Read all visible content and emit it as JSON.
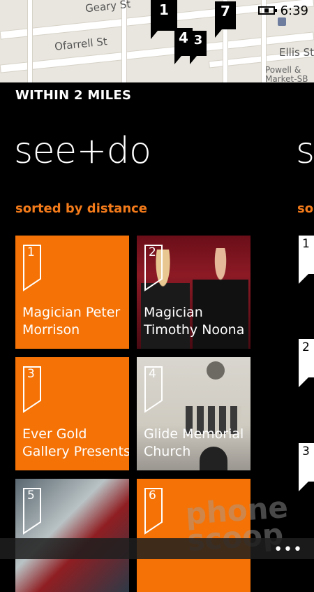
{
  "map": {
    "streets": [
      "Geary St",
      "Ofarrell St",
      "Ellis St"
    ],
    "station_label": "Powell & Market-SB",
    "pins": [
      "1",
      "7",
      "4",
      "3"
    ]
  },
  "status": {
    "time": "6:39",
    "battery_icon": "battery-charging-icon"
  },
  "header": {
    "within": "WITHIN 2 MILES"
  },
  "panorama": {
    "section_title": "see+do",
    "next_title_peek": "s",
    "sorted_label": "sorted by distance",
    "next_sorted_peek": "so"
  },
  "tiles": [
    {
      "num": "1",
      "label_line1": "Magician Peter",
      "label_line2": "Morrison"
    },
    {
      "num": "2",
      "label_line1": "Magician",
      "label_line2": "Timothy Noona"
    },
    {
      "num": "3",
      "label_line1": "Ever Gold",
      "label_line2": "Gallery Presents"
    },
    {
      "num": "4",
      "label_line1": "Glide Memorial",
      "label_line2": "Church"
    },
    {
      "num": "5",
      "label_line1": "",
      "label_line2": ""
    },
    {
      "num": "6",
      "label_line1": "",
      "label_line2": ""
    }
  ],
  "next_column": [
    "1",
    "2",
    "3"
  ],
  "appbar": {
    "more": "•••"
  },
  "watermark": {
    "line1": "phone",
    "line2": "scoop"
  },
  "colors": {
    "accent": "#f47206",
    "background": "#000000"
  }
}
